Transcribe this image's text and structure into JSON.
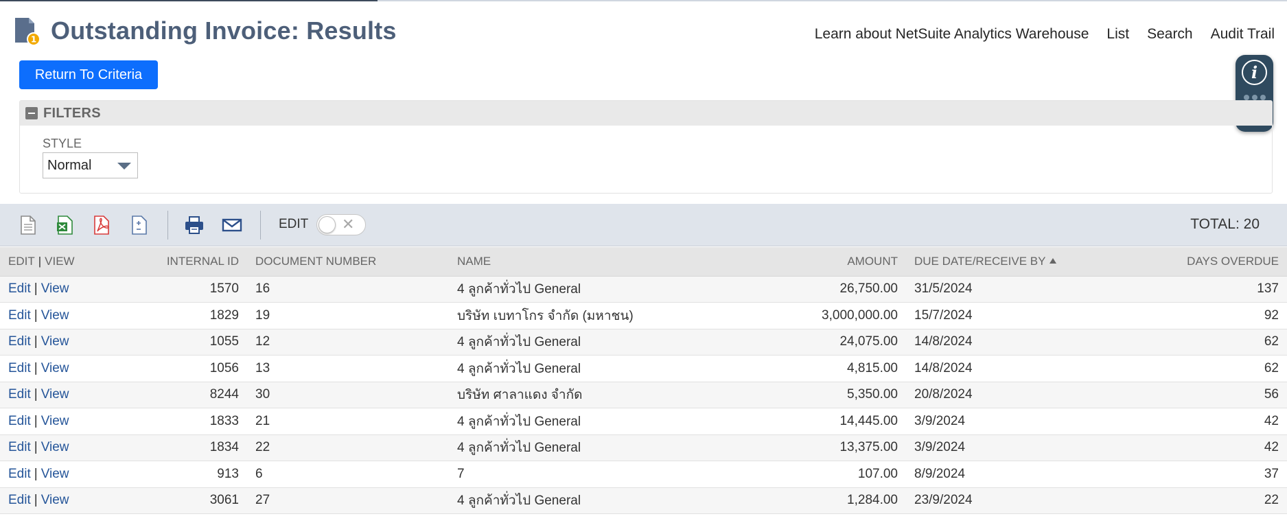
{
  "header": {
    "title": "Outstanding Invoice: Results",
    "links": [
      "Learn about NetSuite Analytics Warehouse",
      "List",
      "Search",
      "Audit Trail"
    ]
  },
  "return_button": "Return To Criteria",
  "filters": {
    "title": "FILTERS",
    "style_label": "STYLE",
    "style_value": "Normal"
  },
  "toolbar": {
    "edit_label": "EDIT",
    "total_label": "TOTAL: 20",
    "icons": [
      "export-csv-icon",
      "export-excel-icon",
      "export-pdf-icon",
      "quick-sum-icon",
      "print-icon",
      "email-icon"
    ]
  },
  "help_widget": {
    "icon": "info-icon"
  },
  "table": {
    "edit_link": "Edit",
    "view_link": "View",
    "separator": "|",
    "headers": [
      "EDIT",
      "VIEW",
      "INTERNAL ID",
      "DOCUMENT NUMBER",
      "NAME",
      "AMOUNT",
      "DUE DATE/RECEIVE BY",
      "DAYS OVERDUE"
    ],
    "rows": [
      {
        "internal_id": "1570",
        "doc_number": "16",
        "name": "4 ลูกค้าทั่วไป General",
        "amount": "26,750.00",
        "due_date": "31/5/2024",
        "days_overdue": "137"
      },
      {
        "internal_id": "1829",
        "doc_number": "19",
        "name": "บริษัท เบทาโกร จำกัด (มหาชน)",
        "amount": "3,000,000.00",
        "due_date": "15/7/2024",
        "days_overdue": "92"
      },
      {
        "internal_id": "1055",
        "doc_number": "12",
        "name": "4 ลูกค้าทั่วไป General",
        "amount": "24,075.00",
        "due_date": "14/8/2024",
        "days_overdue": "62"
      },
      {
        "internal_id": "1056",
        "doc_number": "13",
        "name": "4 ลูกค้าทั่วไป General",
        "amount": "4,815.00",
        "due_date": "14/8/2024",
        "days_overdue": "62"
      },
      {
        "internal_id": "8244",
        "doc_number": "30",
        "name": "บริษัท ศาลาแดง จำกัด",
        "amount": "5,350.00",
        "due_date": "20/8/2024",
        "days_overdue": "56"
      },
      {
        "internal_id": "1833",
        "doc_number": "21",
        "name": "4 ลูกค้าทั่วไป General",
        "amount": "14,445.00",
        "due_date": "3/9/2024",
        "days_overdue": "42"
      },
      {
        "internal_id": "1834",
        "doc_number": "22",
        "name": "4 ลูกค้าทั่วไป General",
        "amount": "13,375.00",
        "due_date": "3/9/2024",
        "days_overdue": "42"
      },
      {
        "internal_id": "913",
        "doc_number": "6",
        "name": "7",
        "amount": "107.00",
        "due_date": "8/9/2024",
        "days_overdue": "37"
      },
      {
        "internal_id": "3061",
        "doc_number": "27",
        "name": "4 ลูกค้าทั่วไป General",
        "amount": "1,284.00",
        "due_date": "23/9/2024",
        "days_overdue": "22"
      }
    ]
  }
}
